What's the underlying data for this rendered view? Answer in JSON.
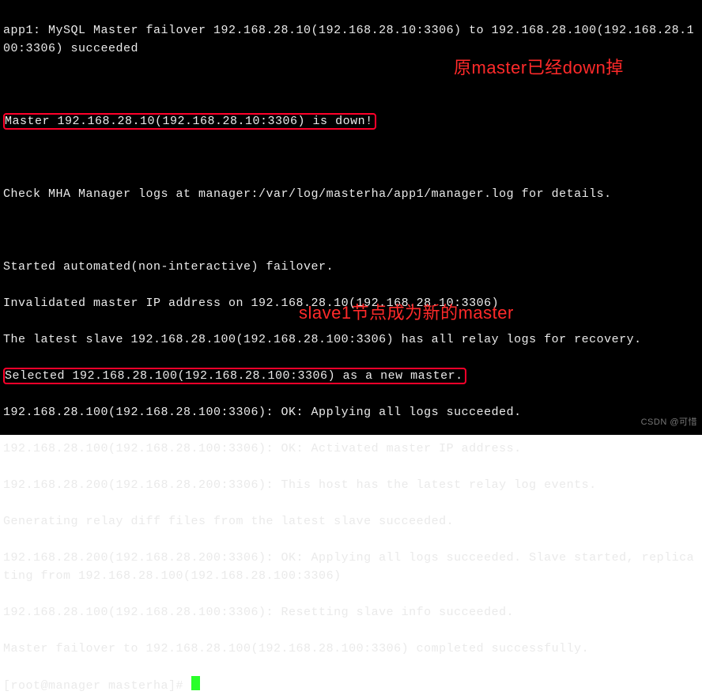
{
  "log": {
    "l1": "app1: MySQL Master failover 192.168.28.10(192.168.28.10:3306) to 192.168.28.100(192.168.28.100:3306) succeeded",
    "blank1": "",
    "l2_boxed": "Master 192.168.28.10(192.168.28.10:3306) is down!",
    "blank2": "",
    "l3": "Check MHA Manager logs at manager:/var/log/masterha/app1/manager.log for details.",
    "blank3": "",
    "l4": "Started automated(non-interactive) failover.",
    "l5": "Invalidated master IP address on 192.168.28.10(192.168.28.10:3306)",
    "l6": "The latest slave 192.168.28.100(192.168.28.100:3306) has all relay logs for recovery.",
    "l7_boxed": "Selected 192.168.28.100(192.168.28.100:3306) as a new master.",
    "l8": "192.168.28.100(192.168.28.100:3306): OK: Applying all logs succeeded.",
    "l9": "192.168.28.100(192.168.28.100:3306): OK: Activated master IP address.",
    "l10": "192.168.28.200(192.168.28.200:3306): This host has the latest relay log events.",
    "l11": "Generating relay diff files from the latest slave succeeded.",
    "l12": "192.168.28.200(192.168.28.200:3306): OK: Applying all logs succeeded. Slave started, replicating from 192.168.28.100(192.168.28.100:3306)",
    "l13": "192.168.28.100(192.168.28.100:3306): Resetting slave info succeeded.",
    "l14": "Master failover to 192.168.28.100(192.168.28.100:3306) completed successfully.",
    "prompt": "[root@manager masterha]# "
  },
  "annotations": {
    "note1": "原master已经down掉",
    "note2": "slave1节点成为新的master"
  },
  "watermark": "CSDN @可惜"
}
